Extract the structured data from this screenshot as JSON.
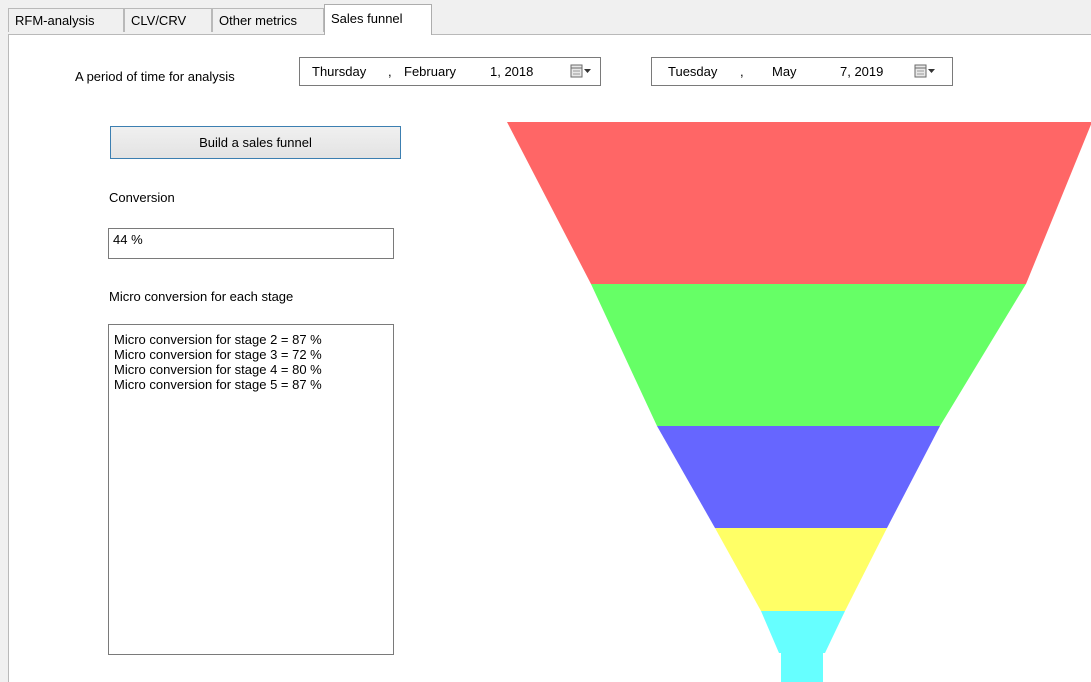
{
  "tabs": [
    {
      "label": "RFM-analysis"
    },
    {
      "label": "CLV/CRV"
    },
    {
      "label": "Other metrics"
    },
    {
      "label": "Sales funnel",
      "active": true
    }
  ],
  "period": {
    "label": "A period of time for analysis",
    "start": {
      "weekday": "Thursday",
      "sep": ",",
      "month": "February",
      "day_year": "1, 2018"
    },
    "end": {
      "weekday": "Tuesday",
      "sep": ",",
      "month": "May",
      "day_year": "7, 2019"
    },
    "picker_icon": "calendar-dropdown-icon"
  },
  "build_button": {
    "label": "Build a sales funnel"
  },
  "conversion": {
    "label": "Conversion",
    "value": "44 %"
  },
  "micro": {
    "label": "Micro conversion for each stage",
    "items": [
      "Micro conversion for stage 2 = 87 %",
      "Micro conversion for stage 3 = 72 %",
      "Micro conversion for stage 4 = 80 %",
      "Micro conversion for stage 5 = 87 %"
    ]
  },
  "funnel": {
    "stages": [
      {
        "stage": 1,
        "color": "#ff6666"
      },
      {
        "stage": 2,
        "color": "#66ff66"
      },
      {
        "stage": 3,
        "color": "#6666ff"
      },
      {
        "stage": 4,
        "color": "#ffff66"
      },
      {
        "stage": 5,
        "color": "#66ffff"
      }
    ]
  }
}
